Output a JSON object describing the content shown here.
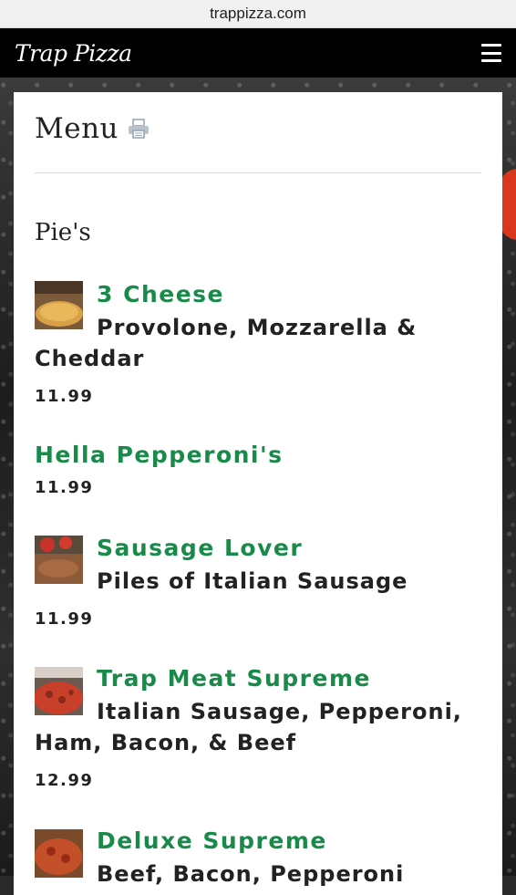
{
  "browser": {
    "url": "trappizza.com"
  },
  "navbar": {
    "brand": "Trap Pizza"
  },
  "page": {
    "title": "Menu",
    "section": "Pie's"
  },
  "items": [
    {
      "name": "3 Cheese",
      "description": "Provolone, Mozzarella & Cheddar",
      "price": "11.99"
    },
    {
      "name": "Hella Pepperoni's",
      "description": "",
      "price": "11.99"
    },
    {
      "name": "Sausage Lover",
      "description": "Piles of Italian Sausage",
      "price": "11.99"
    },
    {
      "name": "Trap Meat Supreme",
      "description": "Italian Sausage, Pepperoni, Ham, Bacon, & Beef",
      "price": "12.99"
    },
    {
      "name": "Deluxe Supreme",
      "description": "Beef, Bacon, Pepperoni",
      "price": ""
    }
  ],
  "colors": {
    "accent": "#1a8a4a",
    "navbar": "#000000",
    "text": "#222222"
  },
  "icons": [
    "hamburger-menu-icon",
    "print-icon"
  ]
}
